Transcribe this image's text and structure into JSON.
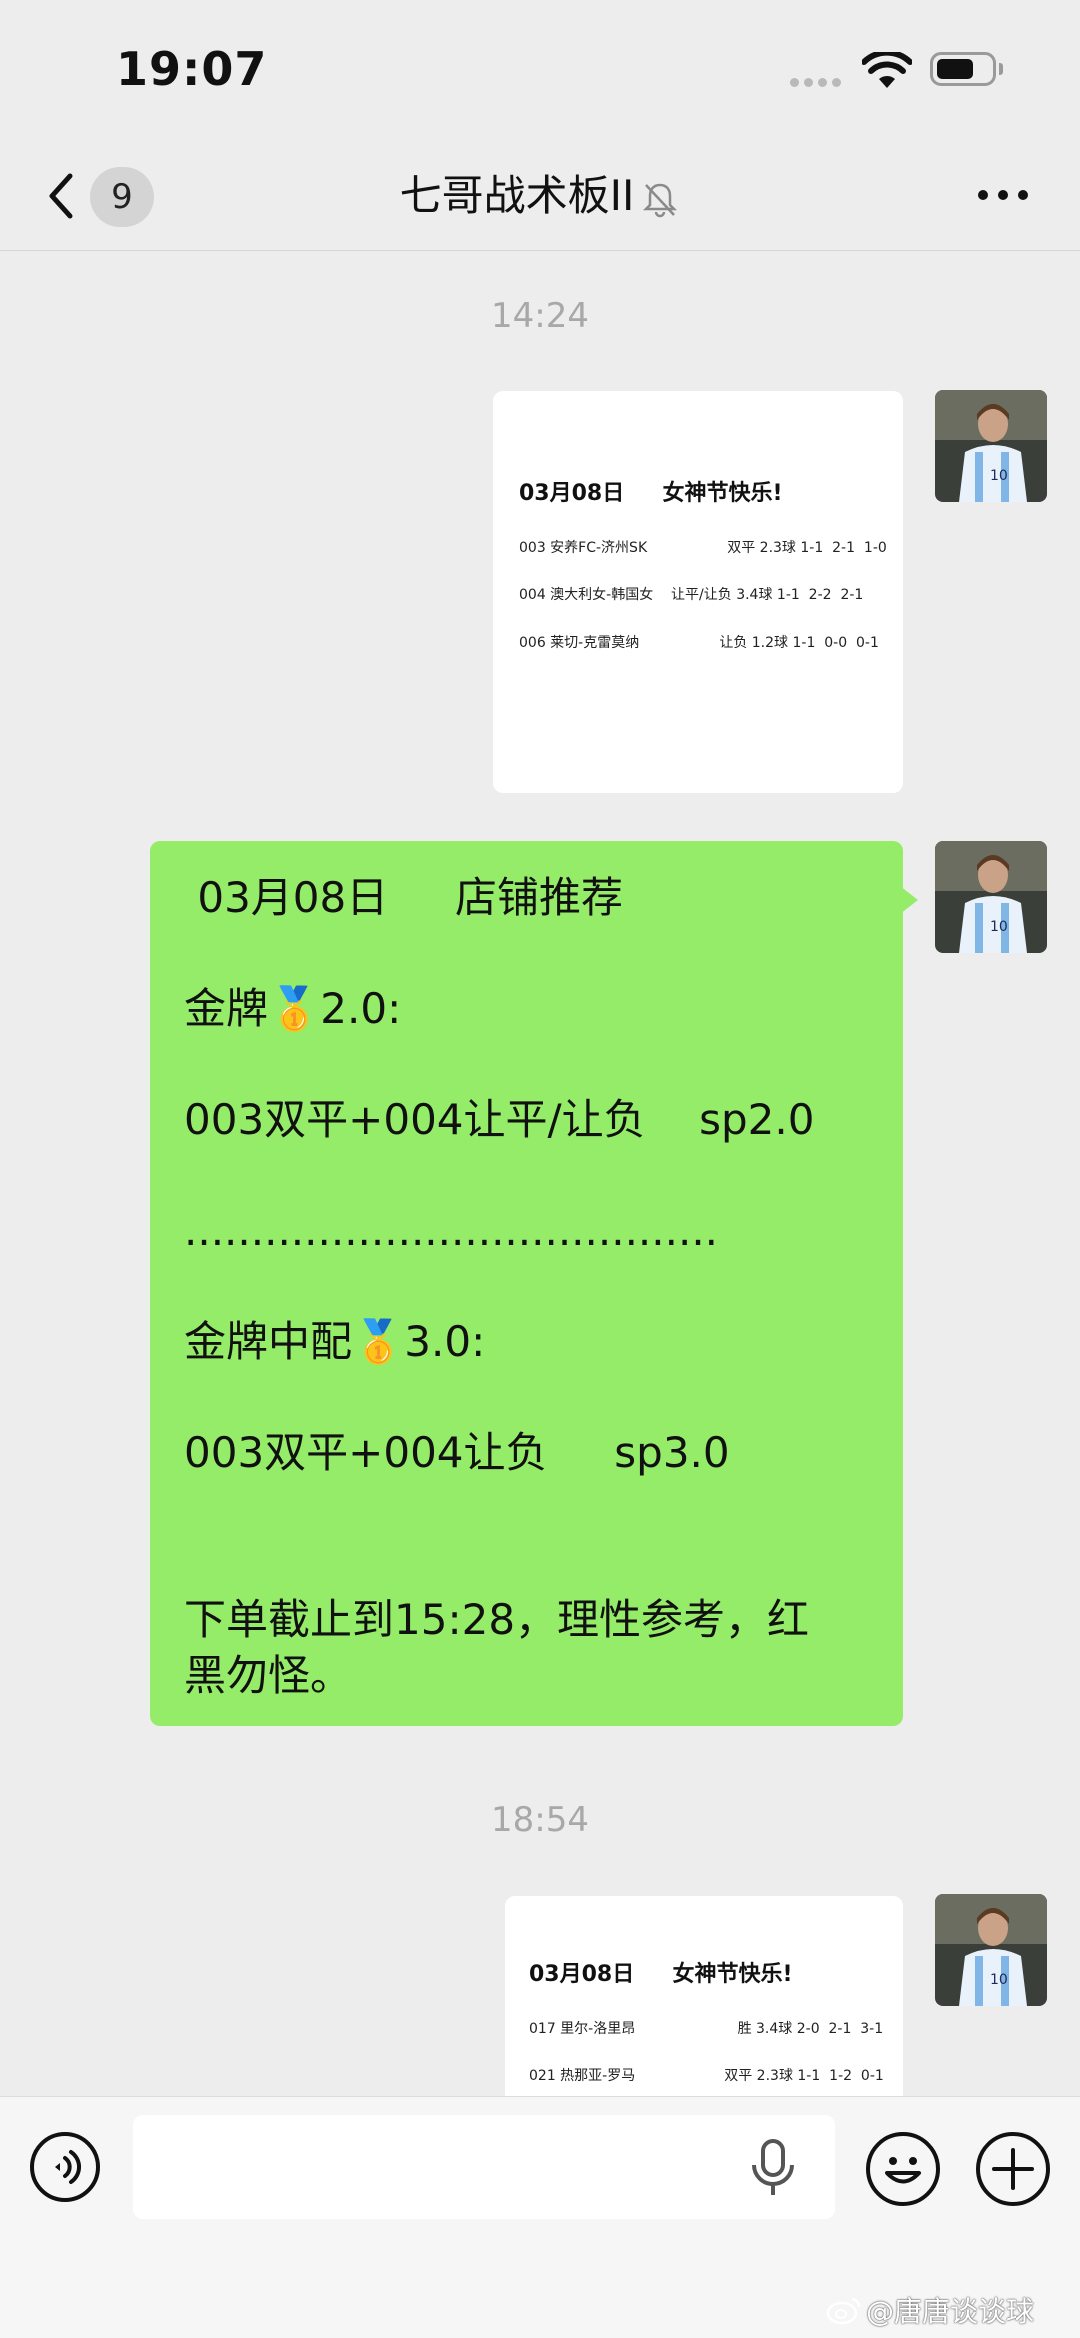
{
  "status_bar": {
    "time": "19:07"
  },
  "nav": {
    "unread_count": "9",
    "title": "七哥战术板II"
  },
  "messages": {
    "timestamp_1": "14:24",
    "image_1": {
      "title": "03月08日     女神节快乐!",
      "rows": [
        "003 安养FC-济州SK                  双平 2.3球 1-1  2-1  1-0",
        "004 澳大利女-韩国女    让平/让负 3.4球 1-1  2-2  2-1",
        "006 莱切-克雷莫纳                  让负 1.2球 1-1  0-0  0-1"
      ]
    },
    "text_1": {
      "lines": [
        " 03月08日     店铺推荐",
        "金牌🥇2.0:",
        "003双平+004让平/让负    sp2.0",
        "........................................",
        "金牌中配🥇3.0:",
        "003双平+004让负     sp3.0",
        "下单截止到15:28，理性参考，红",
        "黑勿怪。"
      ]
    },
    "timestamp_2": "18:54",
    "image_2": {
      "title": "03月08日     女神节快乐!",
      "rows": [
        "017 里尔-洛里昂                       胜 3.4球 2-0  2-1  3-1",
        "021 热那亚-罗马                    双平 2.3球 1-1  1-2  0-1"
      ]
    }
  },
  "input": {
    "placeholder": ""
  },
  "watermark": "@唐唐谈谈球",
  "colors": {
    "bubble": "#95ec69",
    "background": "#ededed",
    "timestamp": "#a8a8a8"
  },
  "icons": [
    "back-arrow-icon",
    "mute-bell-icon",
    "more-icon",
    "voice-icon",
    "microphone-icon",
    "emoji-icon",
    "plus-icon",
    "weibo-icon"
  ]
}
